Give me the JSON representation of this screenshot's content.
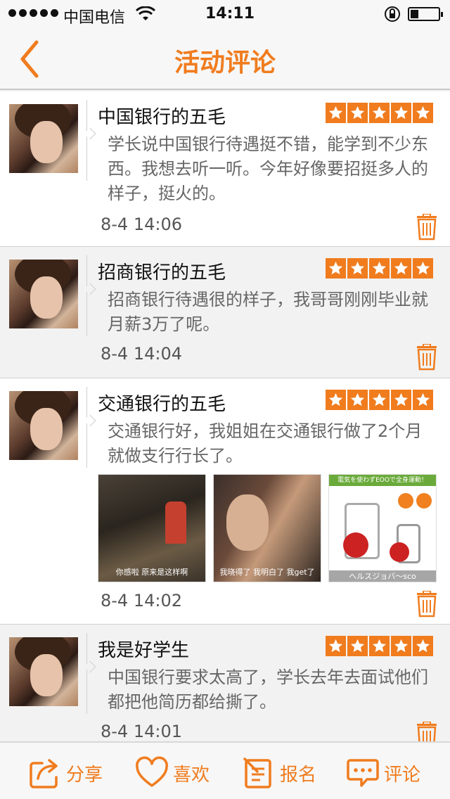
{
  "status_bar": {
    "carrier": "中国电信",
    "time": "14:11",
    "battery_level": 0.3
  },
  "nav": {
    "title": "活动评论",
    "back_icon": "chevron-left-icon"
  },
  "colors": {
    "accent": "#f07c1e",
    "star_bg": "#f07c1e"
  },
  "comments": [
    {
      "name": "中国银行的五毛",
      "rating": 5,
      "content": "学长说中国银行待遇挺不错，能学到不少东西。我想去听一听。今年好像要招挺多人的样子，挺火的。",
      "time": "8-4 14:06",
      "photos": []
    },
    {
      "name": "招商银行的五毛",
      "rating": 5,
      "content": "招商银行待遇很的样子，我哥哥刚刚毕业就月薪3万了呢。",
      "time": "8-4 14:04",
      "photos": []
    },
    {
      "name": "交通银行的五毛",
      "rating": 5,
      "content": "交通银行好，我姐姐在交通银行做了2个月就做支行行长了。",
      "time": "8-4 14:02",
      "photos": [
        {
          "caption": "你感啦 原来是这样啊"
        },
        {
          "caption": "我晓得了 我明白了 我get了"
        },
        {
          "caption": "ヘルスジョバ〜sco",
          "banner": "電気を使わずEOOで全身運動！"
        }
      ]
    },
    {
      "name": "我是好学生",
      "rating": 5,
      "content": "中国银行要求太高了，学长去年去面试他们都把他简历都给撕了。",
      "time": "8-4 14:01",
      "photos": []
    }
  ],
  "bottom_bar": {
    "share": {
      "label": "分享",
      "icon": "share-icon"
    },
    "like": {
      "label": "喜欢",
      "icon": "heart-icon"
    },
    "signup": {
      "label": "报名",
      "icon": "signup-form-icon"
    },
    "comment": {
      "label": "评论",
      "icon": "comment-bubble-icon"
    }
  }
}
